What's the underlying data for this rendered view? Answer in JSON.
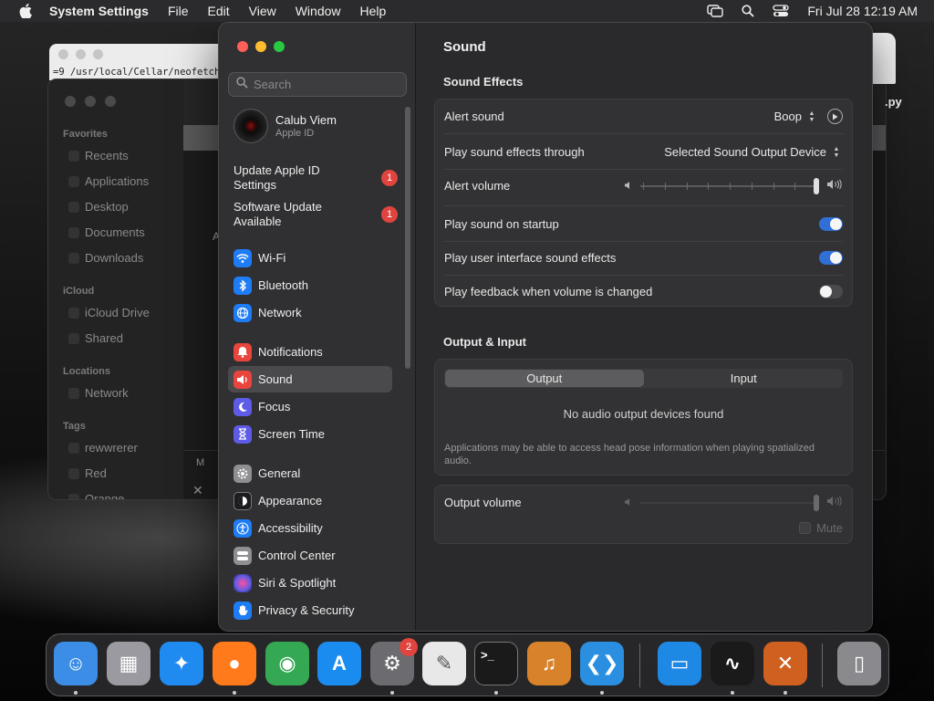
{
  "menubar": {
    "app_name": "System Settings",
    "menus": [
      "File",
      "Edit",
      "View",
      "Window",
      "Help"
    ],
    "clock": "Fri Jul 28  12:19 AM"
  },
  "background_windows": {
    "terminal_path": "=9 /usr/local/Cellar/neofetch",
    "finder": {
      "favorites_label": "Favorites",
      "favorites": [
        "Recents",
        "Applications",
        "Desktop",
        "Documents",
        "Downloads"
      ],
      "icloud_label": "iCloud",
      "icloud": [
        "iCloud Drive",
        "Shared"
      ],
      "locations_label": "Locations",
      "locations": [
        "Network"
      ],
      "tags_label": "Tags",
      "tags": [
        "rewwrerer",
        "Red",
        "Orange"
      ],
      "main_letter": "A",
      "bottom_letter": "M",
      "py_label": ".py"
    }
  },
  "settings": {
    "search_placeholder": "Search",
    "account": {
      "name": "Calub Viem",
      "subtitle": "Apple ID"
    },
    "notices": [
      {
        "text": "Update Apple ID Settings",
        "badge": "1"
      },
      {
        "text": "Software Update Available",
        "badge": "1"
      }
    ],
    "nav": [
      {
        "label": "Wi-Fi",
        "icon": "wifi-icon",
        "color": "#1e7cf5"
      },
      {
        "label": "Bluetooth",
        "icon": "bluetooth-icon",
        "color": "#1e7cf5"
      },
      {
        "label": "Network",
        "icon": "globe-icon",
        "color": "#1e7cf5"
      },
      {
        "label": "Notifications",
        "icon": "bell-icon",
        "color": "#e8463d"
      },
      {
        "label": "Sound",
        "icon": "speaker-icon",
        "color": "#e8463d"
      },
      {
        "label": "Focus",
        "icon": "moon-icon",
        "color": "#5e5ce6"
      },
      {
        "label": "Screen Time",
        "icon": "hourglass-icon",
        "color": "#5e5ce6"
      },
      {
        "label": "General",
        "icon": "gear-icon",
        "color": "#8e8e93"
      },
      {
        "label": "Appearance",
        "icon": "appearance-icon",
        "color": "#1c1c1e"
      },
      {
        "label": "Accessibility",
        "icon": "accessibility-icon",
        "color": "#1e7cf5"
      },
      {
        "label": "Control Center",
        "icon": "control-center-icon",
        "color": "#8e8e93"
      },
      {
        "label": "Siri & Spotlight",
        "icon": "siri-icon",
        "color": "#b03ad6"
      },
      {
        "label": "Privacy & Security",
        "icon": "hand-icon",
        "color": "#1e7cf5"
      }
    ],
    "selected_nav": "Sound",
    "pane": {
      "title": "Sound",
      "sound_effects_title": "Sound Effects",
      "alert_sound_label": "Alert sound",
      "alert_sound_value": "Boop",
      "play_through_label": "Play sound effects through",
      "play_through_value": "Selected Sound Output Device",
      "alert_volume_label": "Alert volume",
      "alert_volume": 1.0,
      "startup_label": "Play sound on startup",
      "startup_on": true,
      "ui_effects_label": "Play user interface sound effects",
      "ui_effects_on": true,
      "feedback_label": "Play feedback when volume is changed",
      "feedback_on": false,
      "output_input_title": "Output & Input",
      "tab_output": "Output",
      "tab_input": "Input",
      "no_devices": "No audio output devices found",
      "head_pose_note": "Applications may be able to access head pose information when playing spatialized audio.",
      "output_volume_label": "Output volume",
      "output_volume": 1.0,
      "mute_label": "Mute",
      "help": "?"
    }
  },
  "dock": {
    "apps": [
      {
        "name": "Finder",
        "icon": "finder-icon",
        "color": "#3b8de6",
        "running": true
      },
      {
        "name": "Launchpad",
        "icon": "launchpad-icon",
        "color": "#9a9aa0",
        "running": false
      },
      {
        "name": "Safari",
        "icon": "safari-icon",
        "color": "#1f8af0",
        "running": false
      },
      {
        "name": "Firefox",
        "icon": "firefox-icon",
        "color": "#ff7a1a",
        "running": true
      },
      {
        "name": "Chrome",
        "icon": "chrome-icon",
        "color": "#34a853",
        "running": false
      },
      {
        "name": "App Store",
        "icon": "app-store-icon",
        "color": "#1a8cf0",
        "running": false
      },
      {
        "name": "System Settings",
        "icon": "system-settings-icon",
        "color": "#6b6b70",
        "running": true,
        "badge": "2"
      },
      {
        "name": "TextEdit",
        "icon": "textedit-icon",
        "color": "#e8e8e8",
        "running": false
      },
      {
        "name": "Terminal",
        "icon": "terminal-icon",
        "color": "#1a1a1a",
        "running": true
      },
      {
        "name": "GarageBand",
        "icon": "garageband-icon",
        "color": "#d8822a",
        "running": false
      },
      {
        "name": "VS Code",
        "icon": "vscode-icon",
        "color": "#2a8fe0",
        "running": true
      },
      {
        "name": "Keynote",
        "icon": "keynote-icon",
        "color": "#1e88e5",
        "running": false
      },
      {
        "name": "Activity Monitor",
        "icon": "activity-monitor-icon",
        "color": "#1a1a1a",
        "running": true
      },
      {
        "name": "X11",
        "icon": "x11-icon",
        "color": "#d06020",
        "running": true
      },
      {
        "name": "Trash",
        "icon": "trash-icon",
        "color": "#8a8a8e",
        "running": false
      }
    ],
    "terminal_prompt": ">_"
  }
}
